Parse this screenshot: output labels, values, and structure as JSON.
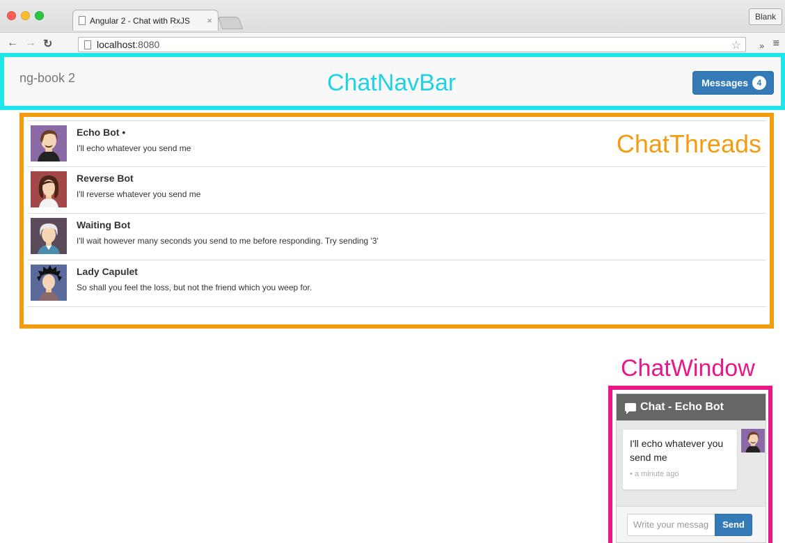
{
  "browser": {
    "tab_title": "Angular 2 - Chat with RxJS",
    "tab_close": "×",
    "blank_label": "Blank",
    "url_host": "localhost",
    "url_port": ":8080",
    "ext_label": "»"
  },
  "navbar": {
    "brand": "ng-book 2",
    "messages_label": "Messages",
    "unread_count": "4"
  },
  "annotations": {
    "navbar": "ChatNavBar",
    "threads": "ChatThreads",
    "window": "ChatWindow"
  },
  "threads": [
    {
      "name": "Echo Bot",
      "unread_marker": " •",
      "message": "I'll echo whatever you send me",
      "avatar": "echo-bot"
    },
    {
      "name": "Reverse Bot",
      "unread_marker": "",
      "message": "I'll reverse whatever you send me",
      "avatar": "reverse-bot"
    },
    {
      "name": "Waiting Bot",
      "unread_marker": "",
      "message": "I'll wait however many seconds you send to me before responding. Try sending '3'",
      "avatar": "waiting-bot"
    },
    {
      "name": "Lady Capulet",
      "unread_marker": "",
      "message": "So shall you feel the loss, but not the friend which you weep for.",
      "avatar": "lady-capulet"
    }
  ],
  "chat_window": {
    "title": "Chat - Echo Bot",
    "messages": [
      {
        "text": "I'll echo whatever you send me",
        "time": "• a minute ago"
      }
    ],
    "input_placeholder": "Write your message...",
    "send_label": "Send"
  },
  "colors": {
    "navbar_annotation": "#1ee5e8",
    "threads_annotation": "#f39c12",
    "window_annotation": "#e8178a",
    "primary_button": "#337ab7"
  }
}
